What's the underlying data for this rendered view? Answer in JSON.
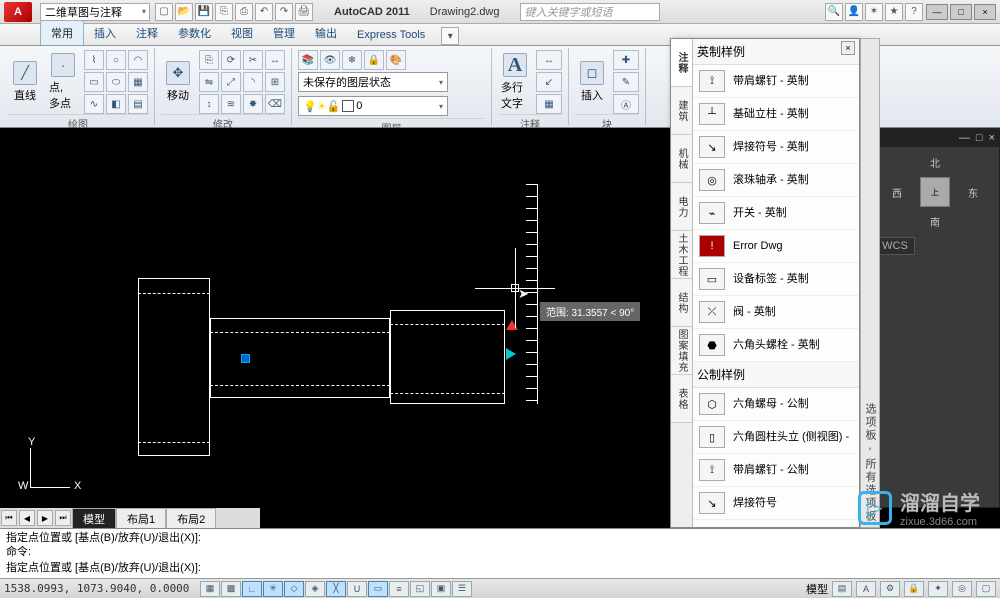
{
  "app": {
    "letter": "A",
    "title": "AutoCAD 2011",
    "filename": "Drawing2.dwg"
  },
  "qat": {
    "workspace": "二维草图与注释"
  },
  "search": {
    "placeholder": "键入关键字或短语"
  },
  "window": {
    "min": "—",
    "max": "□",
    "close": "×"
  },
  "ribbon": {
    "tabs": [
      "常用",
      "插入",
      "注释",
      "参数化",
      "视图",
      "管理",
      "输出",
      "Express Tools"
    ],
    "active": 0,
    "panels": {
      "draw": {
        "title": "绘图",
        "big": [
          {
            "label": "直线",
            "icon": "╱"
          },
          {
            "label": "点, 多点",
            "icon": "·"
          }
        ]
      },
      "modify": {
        "title": "修改",
        "big": [
          {
            "label": "移动",
            "icon": "✥"
          }
        ]
      },
      "layer": {
        "title": "图层",
        "state": "未保存的图层状态",
        "current_color": "#ffffff",
        "current_name": "0"
      },
      "annot": {
        "title": "注释",
        "big": [
          {
            "label": "多行文字",
            "icon": "A"
          }
        ]
      },
      "block": {
        "title": "块",
        "big": [
          {
            "label": "插入",
            "icon": "◻"
          }
        ]
      }
    }
  },
  "canvas": {
    "tooltip": "范围: 31.3557 < 90°",
    "ucs": {
      "x": "X",
      "y": "Y",
      "o": "W"
    },
    "layout_tabs": [
      "模型",
      "布局1",
      "布局2"
    ],
    "active_layout": 0
  },
  "nav": {
    "compass": {
      "n": "北",
      "s": "南",
      "e": "东",
      "w": "西"
    },
    "wcs": "WCS"
  },
  "palette": {
    "close": "×",
    "side_tabs": [
      "注释",
      "建筑",
      "机械",
      "电力",
      "土木工程",
      "结构",
      "图案填充",
      "表格"
    ],
    "active_side": 0,
    "title_strip": "选项板 - 所有选项板",
    "sections": [
      {
        "header": "英制样例",
        "items": [
          {
            "text": "带肩螺钉 - 英制",
            "icon": "⟟"
          },
          {
            "text": "基础立柱 - 英制",
            "icon": "┴"
          },
          {
            "text": "焊接符号 - 英制",
            "icon": "↘"
          },
          {
            "text": "滚珠轴承 - 英制",
            "icon": "◎"
          },
          {
            "text": "开关 - 英制",
            "icon": "⌁"
          },
          {
            "text": "Error Dwg",
            "icon": "!"
          },
          {
            "text": "设备标签 - 英制",
            "icon": "▭"
          },
          {
            "text": "阀 - 英制",
            "icon": "⤫"
          },
          {
            "text": "六角头螺栓 - 英制",
            "icon": "⬣"
          }
        ]
      },
      {
        "header": "公制样例",
        "items": [
          {
            "text": "六角螺母 - 公制",
            "icon": "⬡"
          },
          {
            "text": "六角圆柱头立 (侧视图) -",
            "icon": "▯"
          },
          {
            "text": "带肩螺钉 - 公制",
            "icon": "⟟"
          },
          {
            "text": "焊接符号",
            "icon": "↘"
          }
        ]
      }
    ]
  },
  "cmd": {
    "history": [
      "指定点位置或 [基点(B)/放弃(U)/退出(X)]:",
      "命令:"
    ],
    "prompt": "指定点位置或 [基点(B)/放弃(U)/退出(X)]:"
  },
  "status": {
    "coords": "1538.0993, 1073.9040, 0.0000",
    "right_label": "模型"
  },
  "watermark": {
    "main": "溜溜自学",
    "sub": "zixue.3d66.com"
  }
}
